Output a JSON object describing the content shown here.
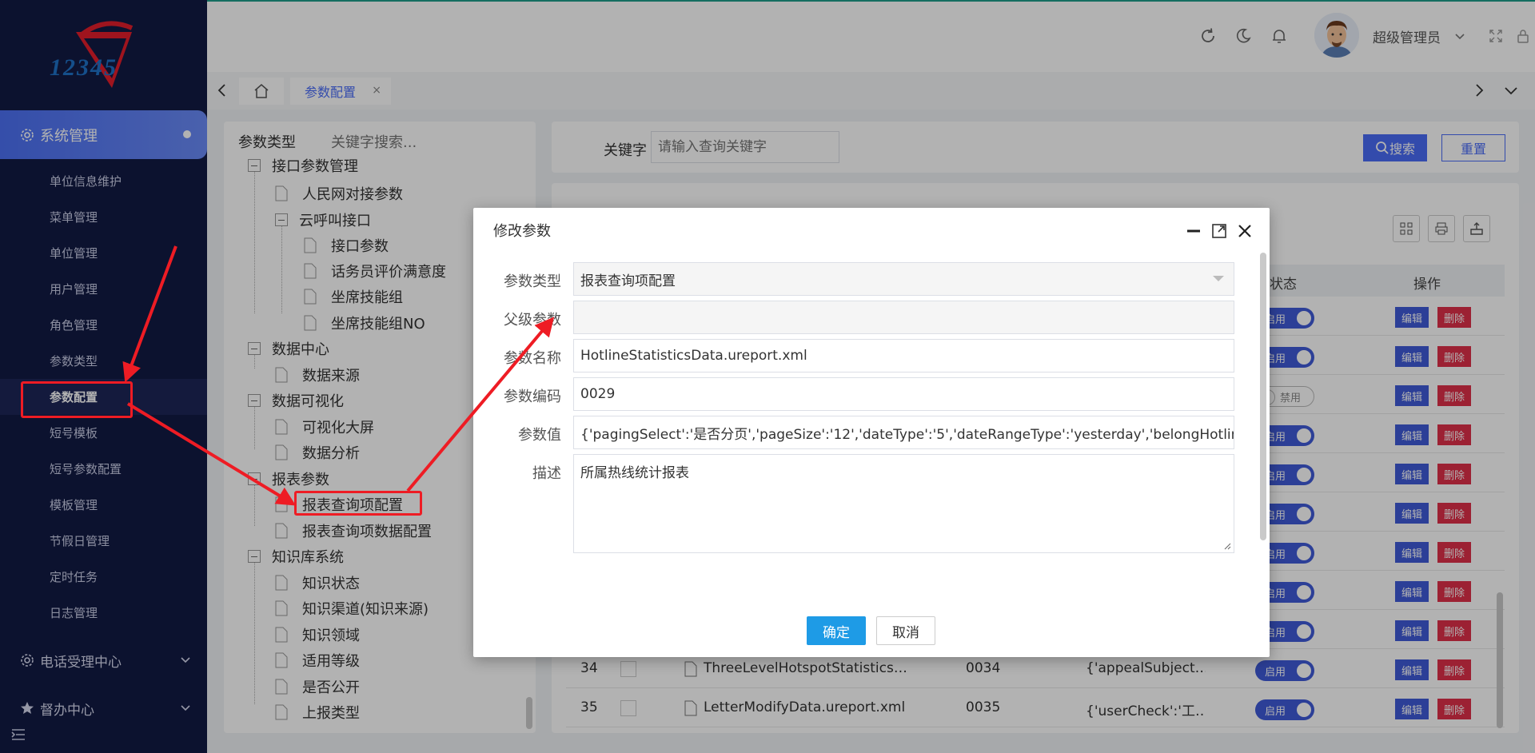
{
  "sidebar": {
    "logo_text": "12345",
    "active_menu": "系统管理",
    "sub_items": [
      "单位信息维护",
      "菜单管理",
      "单位管理",
      "用户管理",
      "角色管理",
      "参数类型",
      "参数配置",
      "短号模板",
      "短号参数配置",
      "模板管理",
      "节假日管理",
      "定时任务",
      "日志管理"
    ],
    "active_sub_index": 6,
    "groups": [
      "电话受理中心",
      "督办中心"
    ]
  },
  "header": {
    "user_name": "超级管理员"
  },
  "tabs": {
    "current": "参数配置",
    "close_glyph": "×"
  },
  "tree": {
    "title": "参数类型",
    "search_placeholder": "关键字搜索...",
    "nodes": {
      "n0": "接口参数管理",
      "n1": "人民网对接参数",
      "n2": "云呼叫接口",
      "n3": "接口参数",
      "n4": "话务员评价满意度",
      "n5": "坐席技能组",
      "n6": "坐席技能组NO",
      "n7": "数据中心",
      "n8": "数据来源",
      "n9": "数据可视化",
      "n10": "可视化大屏",
      "n11": "数据分析",
      "n12": "报表参数",
      "n13": "报表查询项配置",
      "n14": "报表查询项数据配置",
      "n15": "知识库系统",
      "n16": "知识状态",
      "n17": "知识渠道(知识来源)",
      "n18": "知识领域",
      "n19": "适用等级",
      "n20": "是否公开",
      "n21": "上报类型"
    }
  },
  "search": {
    "keyword_label": "关键字",
    "keyword_placeholder": "请输入查询关键字",
    "search_button": "搜索",
    "reset_button": "重置"
  },
  "table": {
    "col_status": "状态",
    "col_ops": "操作",
    "enabled_label": "启用",
    "disabled_label": "禁用",
    "edit_label": "编辑",
    "delete_label": "删除",
    "row34": {
      "index": "34",
      "name": "ThreeLevelHotspotStatistics…",
      "code": "0034",
      "value": "{'appealSubject…"
    },
    "row35": {
      "index": "35",
      "name": "LetterModifyData.ureport.xml",
      "code": "0035",
      "value": "{'userCheck':'工…"
    }
  },
  "dialog": {
    "title": "修改参数",
    "labels": {
      "type": "参数类型",
      "parent": "父级参数",
      "name": "参数名称",
      "code": "参数编码",
      "value": "参数值",
      "desc": "描述"
    },
    "values": {
      "type": "报表查询项配置",
      "parent": "",
      "name": "HotlineStatisticsData.ureport.xml",
      "code": "0029",
      "value": "{'pagingSelect':'是否分页','pageSize':'12','dateType':'5','dateRangeType':'yesterday','belongHotlineXmSelect'",
      "desc": "所属热线统计报表"
    },
    "ok_button": "确定",
    "cancel_button": "取消"
  },
  "colors": {
    "sidebar_bg": "#121a44",
    "accent": "#4a6cf7",
    "danger": "#e0304a",
    "ok": "#1e9be6",
    "annotation": "#ee1c24"
  }
}
